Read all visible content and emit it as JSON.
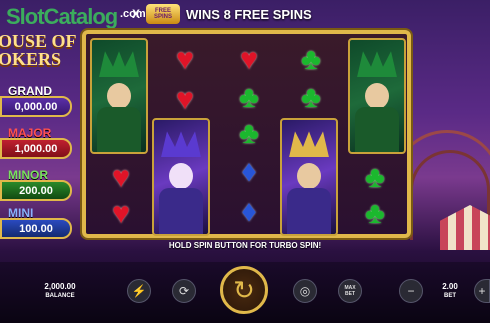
{
  "watermark": {
    "brand": "SlotCatalog",
    "suffix": ".com"
  },
  "logo": {
    "line1": "OUSE OF",
    "line2": "OKERS"
  },
  "banner": {
    "badge": "FREE SPINS",
    "multiplier": "X",
    "text": "WINS 8 FREE SPINS"
  },
  "jackpots": [
    {
      "label": "GRAND",
      "value": "0,000.00"
    },
    {
      "label": "MAJOR",
      "value": "1,000.00"
    },
    {
      "label": "MINOR",
      "value": "200.00"
    },
    {
      "label": "MINI",
      "value": "100.00"
    }
  ],
  "reels": [
    [
      "jester-green"
    ],
    [
      "heart",
      "heart",
      "purple-jester"
    ],
    [
      "heart",
      "heart",
      "club",
      "diamond",
      "diamond"
    ],
    [
      "club",
      "club",
      "club",
      "purple-jester"
    ],
    [
      "jester-green",
      "club",
      "club"
    ]
  ],
  "hint": "HOLD SPIN BUTTON FOR TURBO SPIN!",
  "bottom": {
    "balance_value": "2,000.00",
    "balance_label": "BALANCE",
    "bet_value": "2.00",
    "bet_label": "BET",
    "maxbet_label": "MAX BET",
    "icons": {
      "turbo": "lightning-icon",
      "autoplay": "autoplay-icon",
      "spin": "spin-icon",
      "coins": "coins-icon",
      "minus": "minus-icon",
      "plus": "plus-icon"
    }
  },
  "colors": {
    "gold": "#e0b84a",
    "heart": "#e01428",
    "club": "#1bb82e",
    "diamond": "#2856d8"
  }
}
